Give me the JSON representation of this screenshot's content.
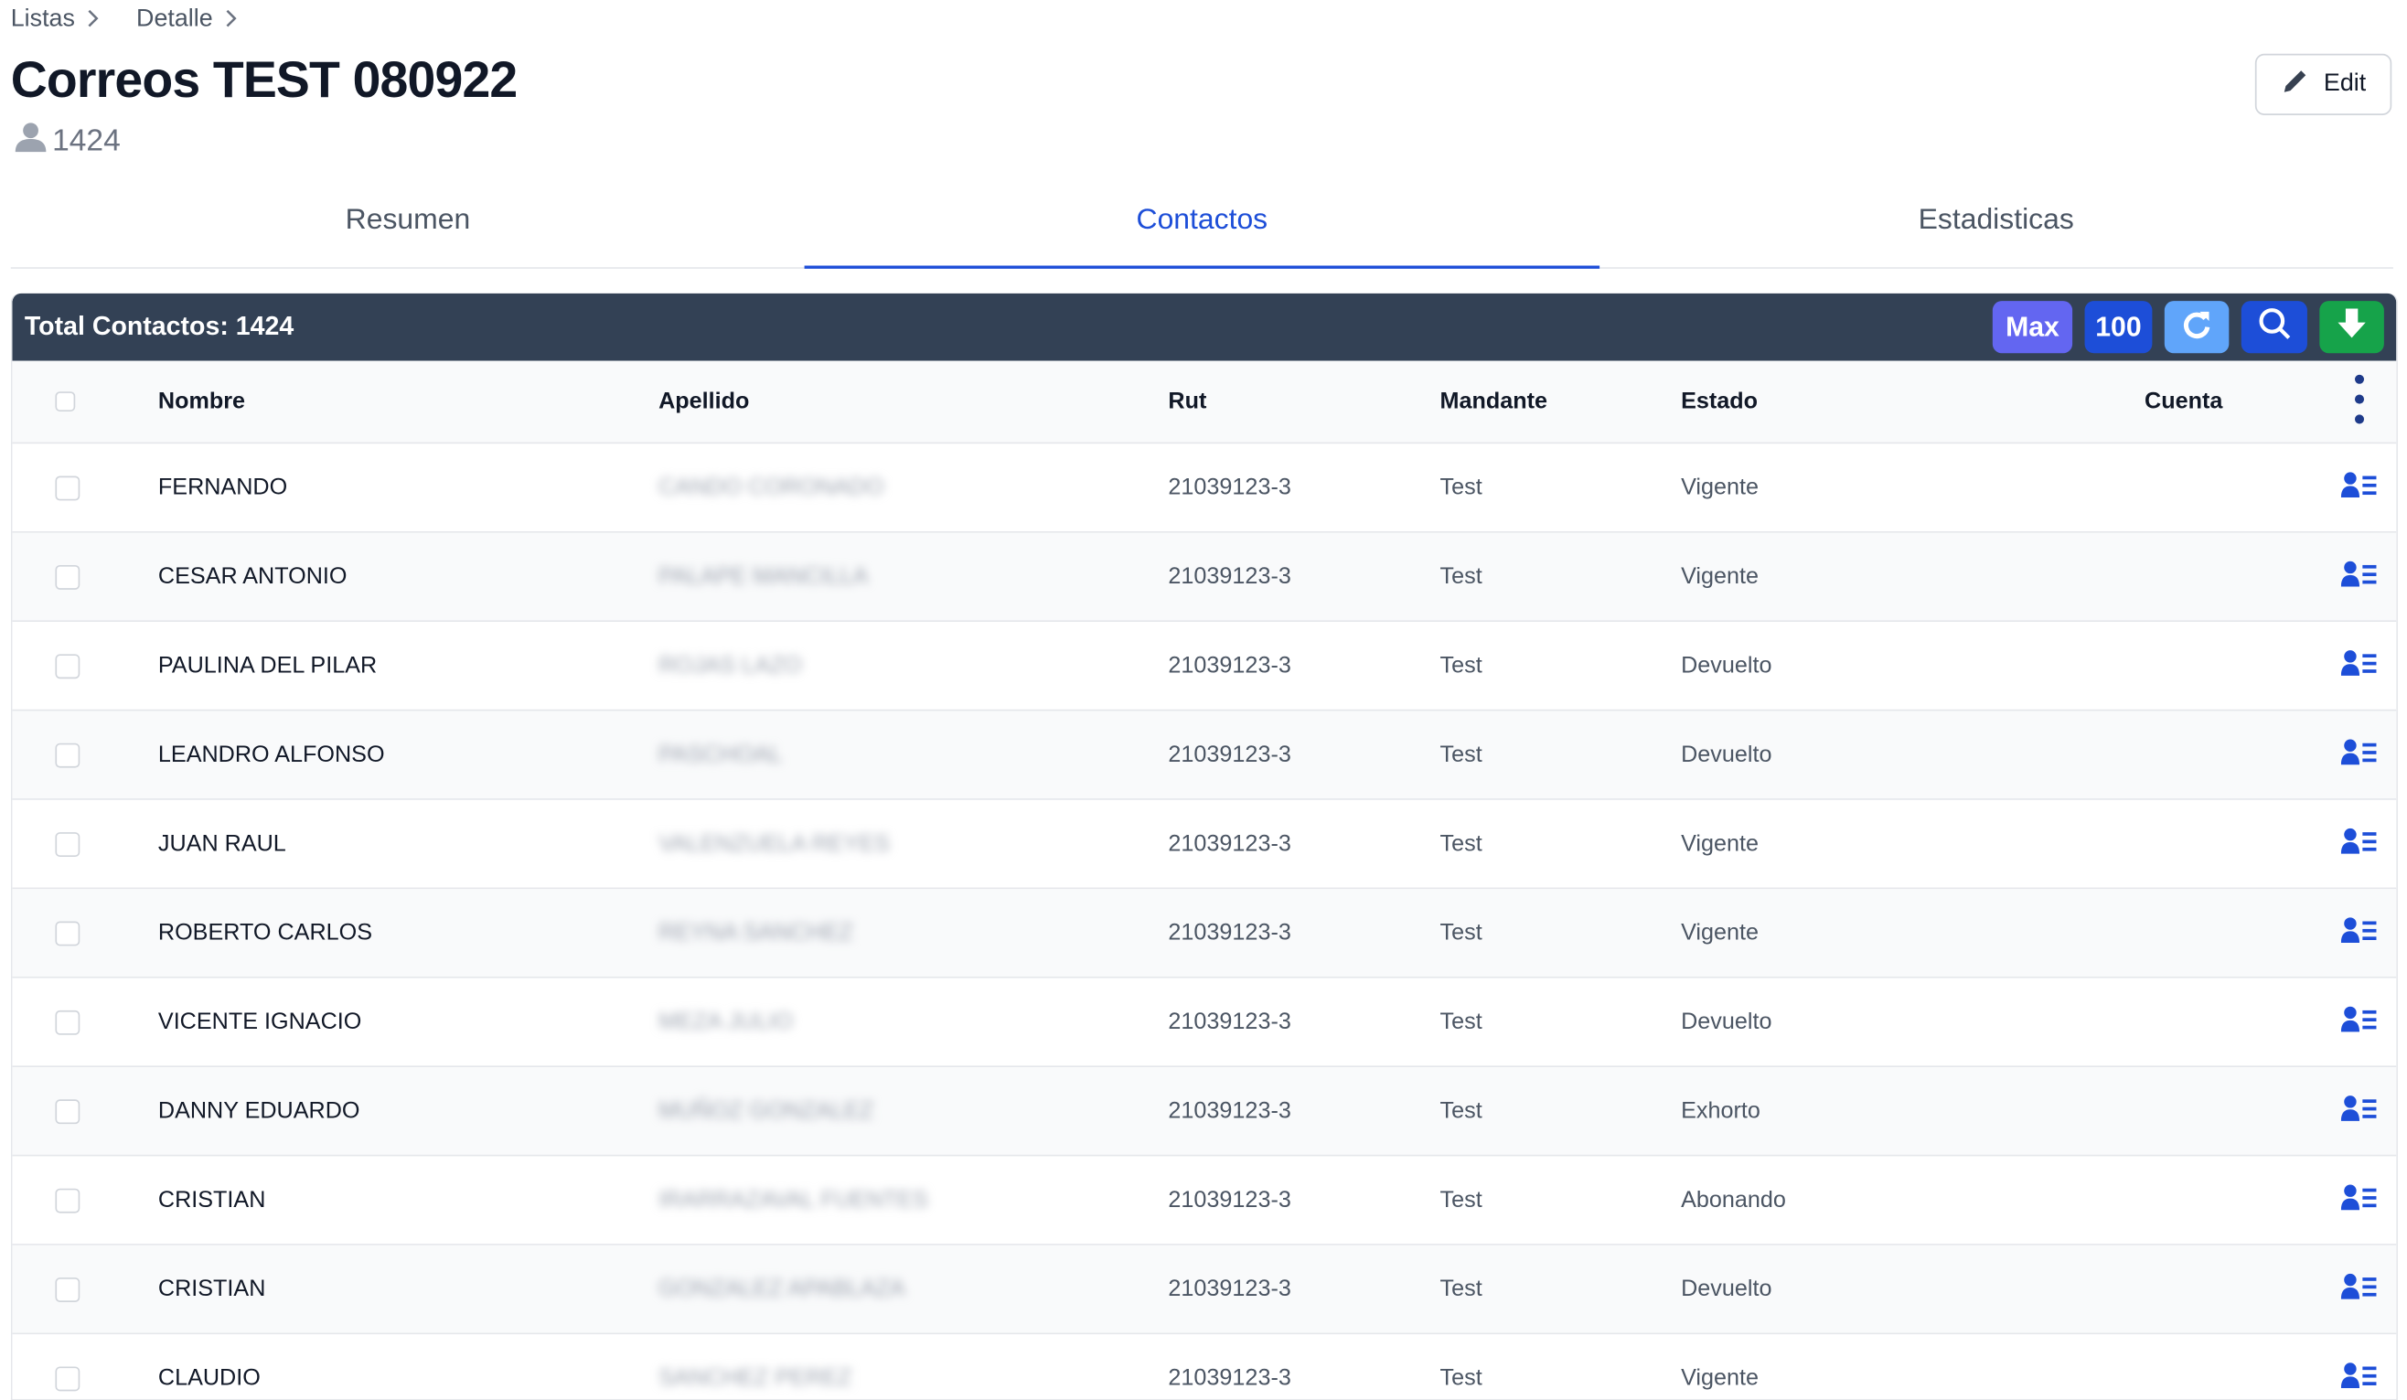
{
  "breadcrumb": [
    "Listas",
    "Detalle"
  ],
  "title": "Correos TEST 080922",
  "contact_count": "1424",
  "edit_label": "Edit",
  "tabs": [
    "Resumen",
    "Contactos",
    "Estadisticas"
  ],
  "active_tab": "Contactos",
  "table": {
    "total_label": "Total Contactos: 1424",
    "tools": {
      "max": "Max",
      "hundred": "100"
    },
    "columns": [
      "Nombre",
      "Apellido",
      "Rut",
      "Mandante",
      "Estado",
      "Cuenta"
    ],
    "rows": [
      {
        "nombre": "FERNANDO",
        "apellido": "CANDO CORONADO",
        "rut": "21039123-3",
        "mandante": "Test",
        "estado": "Vigente"
      },
      {
        "nombre": "CESAR ANTONIO",
        "apellido": "PALAPE MANCILLA",
        "rut": "21039123-3",
        "mandante": "Test",
        "estado": "Vigente"
      },
      {
        "nombre": "PAULINA DEL PILAR",
        "apellido": "ROJAS LAZO",
        "rut": "21039123-3",
        "mandante": "Test",
        "estado": "Devuelto"
      },
      {
        "nombre": "LEANDRO ALFONSO",
        "apellido": "PASCHOAL",
        "rut": "21039123-3",
        "mandante": "Test",
        "estado": "Devuelto"
      },
      {
        "nombre": "JUAN RAUL",
        "apellido": "VALENZUELA REYES",
        "rut": "21039123-3",
        "mandante": "Test",
        "estado": "Vigente"
      },
      {
        "nombre": "ROBERTO CARLOS",
        "apellido": "REYNA SANCHEZ",
        "rut": "21039123-3",
        "mandante": "Test",
        "estado": "Vigente"
      },
      {
        "nombre": "VICENTE IGNACIO",
        "apellido": "MEZA JULIO",
        "rut": "21039123-3",
        "mandante": "Test",
        "estado": "Devuelto"
      },
      {
        "nombre": "DANNY EDUARDO",
        "apellido": "MUÑOZ GONZALEZ",
        "rut": "21039123-3",
        "mandante": "Test",
        "estado": "Exhorto"
      },
      {
        "nombre": "CRISTIAN",
        "apellido": "IRARRAZAVAL FUENTES",
        "rut": "21039123-3",
        "mandante": "Test",
        "estado": "Abonando"
      },
      {
        "nombre": "CRISTIAN",
        "apellido": "GONZALEZ APABLAZA",
        "rut": "21039123-3",
        "mandante": "Test",
        "estado": "Devuelto"
      },
      {
        "nombre": "CLAUDIO",
        "apellido": "SANCHEZ PEREZ",
        "rut": "21039123-3",
        "mandante": "Test",
        "estado": "Vigente"
      }
    ]
  },
  "colors": {
    "header_bar": "#334155",
    "accent": "#1d4ed8",
    "max_btn": "#6366f1",
    "refresh_btn": "#60a5fa",
    "download_btn": "#16a34a"
  }
}
